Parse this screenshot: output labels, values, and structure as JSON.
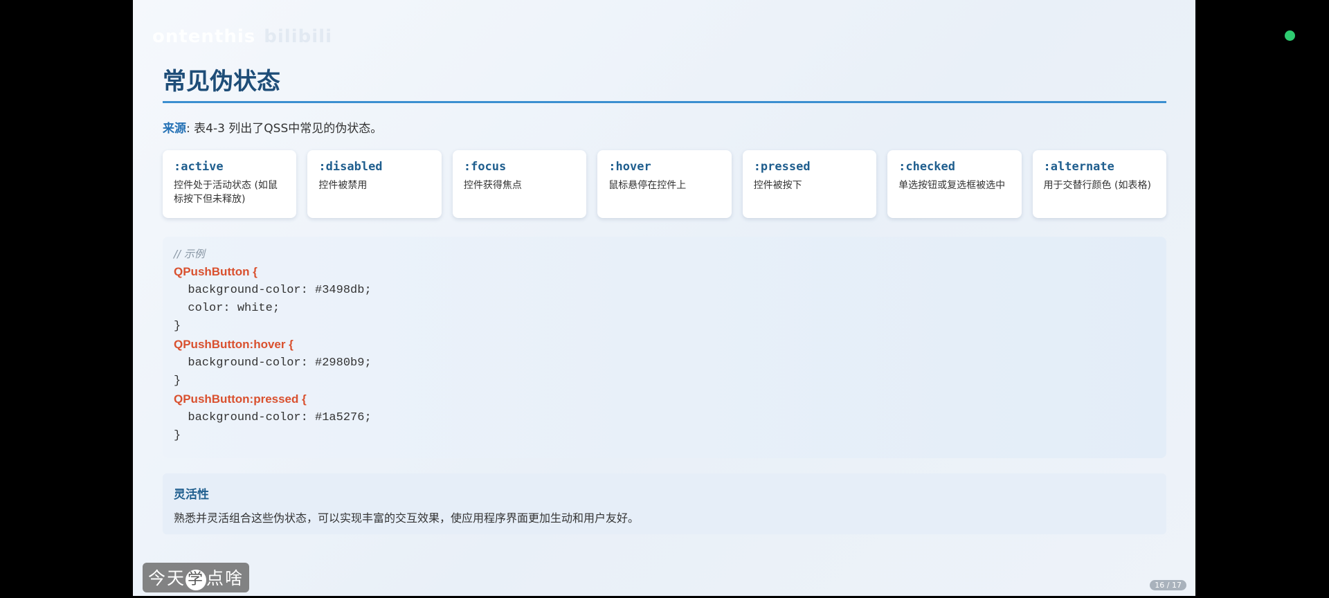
{
  "watermark": {
    "primary": "ontenthis",
    "secondary": "bilibili"
  },
  "title": "常见伪状态",
  "source": {
    "label": "来源",
    "text": ": 表4-3 列出了QSS中常见的伪状态。"
  },
  "cards": [
    {
      "name": ":active",
      "desc": "控件处于活动状态 (如鼠标按下但未释放)"
    },
    {
      "name": ":disabled",
      "desc": "控件被禁用"
    },
    {
      "name": ":focus",
      "desc": "控件获得焦点"
    },
    {
      "name": ":hover",
      "desc": "鼠标悬停在控件上"
    },
    {
      "name": ":pressed",
      "desc": "控件被按下"
    },
    {
      "name": ":checked",
      "desc": "单选按钮或复选框被选中"
    },
    {
      "name": ":alternate",
      "desc": "用于交替行颜色 (如表格)"
    }
  ],
  "code": {
    "comment": "// 示例",
    "sel1": "QPushButton {",
    "l1": "  background-color: #3498db;",
    "l2": "  color: white;",
    "close": "}",
    "sel2": "QPushButton:hover {",
    "l3": "  background-color: #2980b9;",
    "sel3": "QPushButton:pressed {",
    "l4": "  background-color: #1a5276;"
  },
  "note": {
    "heading": "灵活性",
    "text": "熟悉并灵活组合这些伪状态，可以实现丰富的交互效果，使应用程序界面更加生动和用户友好。"
  },
  "badge": {
    "a": "今天",
    "b": "学",
    "c": "点啥"
  },
  "pager": "16 / 17",
  "colors": {
    "accent": "#1e4d78",
    "rule": "#3b8fd0",
    "selector": "#d9502e",
    "green_dot": "#2ecc71"
  }
}
